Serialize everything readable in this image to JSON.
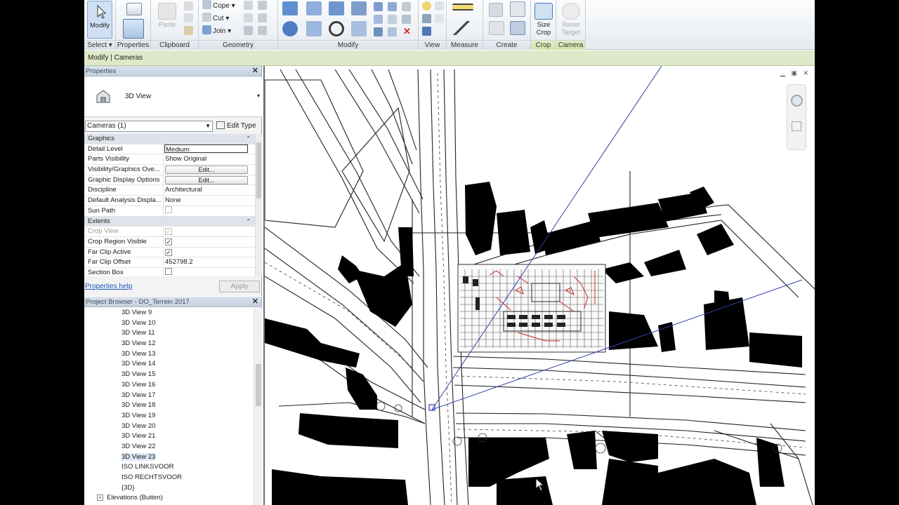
{
  "ribbon": {
    "select": {
      "button": "Modify",
      "label": "Select"
    },
    "properties": {
      "label": "Properties"
    },
    "clipboard": {
      "paste": "Paste",
      "label": "Clipboard"
    },
    "geometry": {
      "cope": "Cope",
      "cut": "Cut",
      "join": "Join",
      "label": "Geometry"
    },
    "modify": {
      "label": "Modify"
    },
    "view": {
      "label": "View"
    },
    "measure": {
      "label": "Measure"
    },
    "create": {
      "label": "Create"
    },
    "crop": {
      "button_line1": "Size",
      "button_line2": "Crop",
      "label": "Crop"
    },
    "camera": {
      "button_line1": "Reset",
      "button_line2": "Target",
      "label": "Camera"
    }
  },
  "context_bar": {
    "text": "Modify | Cameras"
  },
  "properties": {
    "title": "Properties",
    "type_name": "3D View",
    "instance_filter": "Cameras (1)",
    "edit_type": "Edit Type",
    "groups": [
      {
        "name": "Graphics",
        "rows": [
          {
            "key": "Detail Level",
            "value": "Medium",
            "kind": "text",
            "selected": true
          },
          {
            "key": "Parts Visibility",
            "value": "Show Original",
            "kind": "text"
          },
          {
            "key": "Visibility/Graphics Ove...",
            "value": "Edit...",
            "kind": "button"
          },
          {
            "key": "Graphic Display Options",
            "value": "Edit...",
            "kind": "button"
          },
          {
            "key": "Discipline",
            "value": "Architectural",
            "kind": "text"
          },
          {
            "key": "Default Analysis Displa...",
            "value": "None",
            "kind": "text"
          },
          {
            "key": "Sun Path",
            "value": "",
            "kind": "checkbox",
            "checked": false,
            "disabled": true
          }
        ]
      },
      {
        "name": "Extents",
        "rows": [
          {
            "key": "Crop View",
            "value": "",
            "kind": "checkbox",
            "checked": true,
            "disabled": true
          },
          {
            "key": "Crop Region Visible",
            "value": "",
            "kind": "checkbox",
            "checked": true
          },
          {
            "key": "Far Clip Active",
            "value": "",
            "kind": "checkbox",
            "checked": true
          },
          {
            "key": "Far Clip Offset",
            "value": "452798.2",
            "kind": "text"
          },
          {
            "key": "Section Box",
            "value": "",
            "kind": "checkbox",
            "checked": false
          }
        ]
      }
    ],
    "help_link": "Properties help",
    "apply": "Apply"
  },
  "project_browser": {
    "title": "Project Browser - DO_Terrein 2017",
    "items": [
      "3D View 9",
      "3D View 10",
      "3D View 11",
      "3D View 12",
      "3D View 13",
      "3D View 14",
      "3D View 15",
      "3D View 16",
      "3D View 17",
      "3D View 18",
      "3D View 19",
      "3D View 20",
      "3D View 21",
      "3D View 22",
      "3D View 23",
      "ISO LINKSVOOR",
      "ISO RECHTSVOOR",
      "{3D}"
    ],
    "selected": "3D View 23",
    "elevations": "Elevations (Buiten)"
  },
  "colors": {
    "accent": "#2f64c8",
    "context_bar": "#dfe8c8",
    "camera_line": "#2f3fb0",
    "red_markup": "#d02020"
  }
}
